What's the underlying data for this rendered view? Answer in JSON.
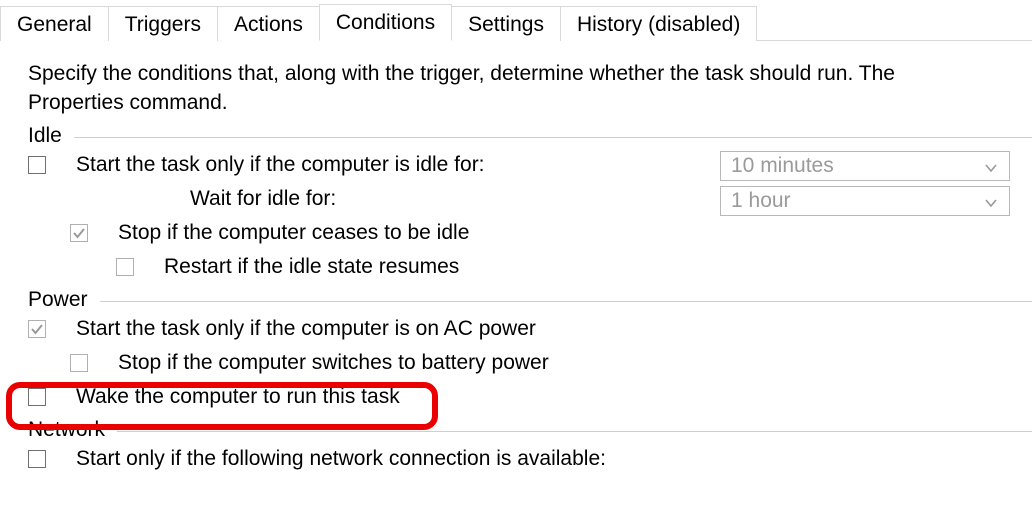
{
  "tabs": {
    "general": "General",
    "triggers": "Triggers",
    "actions": "Actions",
    "conditions": "Conditions",
    "settings": "Settings",
    "history": "History (disabled)"
  },
  "intro": "Specify the conditions that, along with the trigger, determine whether the task should run.  The\nProperties command.",
  "sections": {
    "idle": "Idle",
    "power": "Power",
    "network": "Network"
  },
  "idle": {
    "start_only_if_idle": "Start the task only if the computer is idle for:",
    "wait_for_idle": "Wait for idle for:",
    "stop_if_not_idle": "Stop if the computer ceases to be idle",
    "restart_if_idle": "Restart if the idle state resumes",
    "combo_idle_for": "10 minutes",
    "combo_wait_for": "1 hour"
  },
  "power": {
    "start_on_ac": "Start the task only if the computer is on AC power",
    "stop_on_batt": "Stop if the computer switches to battery power",
    "wake_to_run": "Wake the computer to run this task"
  },
  "network": {
    "start_if_conn": "Start only if the following network connection is available:"
  }
}
